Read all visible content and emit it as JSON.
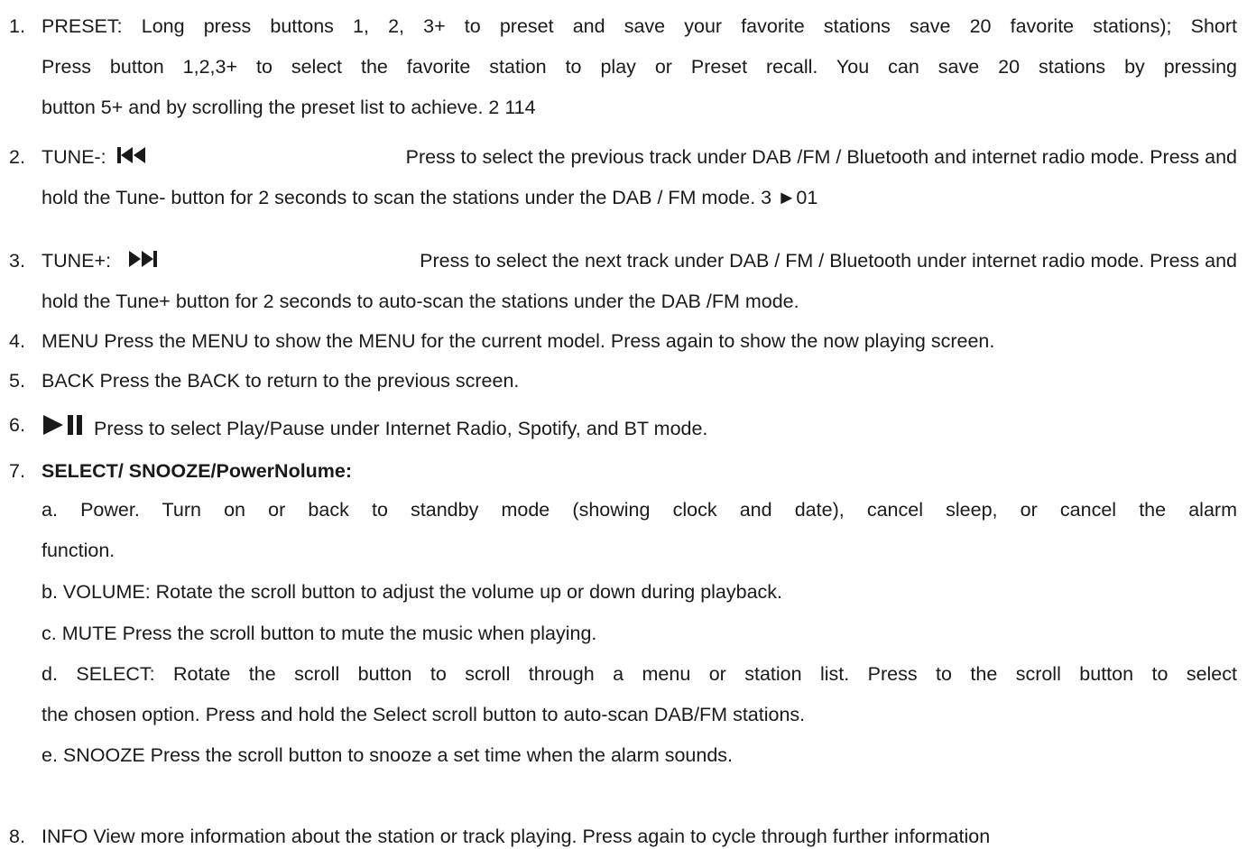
{
  "items": [
    {
      "number": "1.",
      "lines": [
        "PRESET: Long press buttons 1, 2, 3+ to preset and save your favorite stations save 20 favorite stations); Short",
        "Press button 1,2,3+ to select the favorite station to play or Preset recall. You can save 20 stations by pressing",
        "button 5+ and by scrolling the preset list to achieve. 2 114"
      ]
    },
    {
      "number": "2.",
      "label": "TUNE-:",
      "icon": "skip-previous-icon",
      "line1_rest": "Press to select the previous track under DAB /FM / Bluetooth and internet radio mode. Press and",
      "line2": "hold the Tune- button for 2 seconds to scan the stations under the DAB / FM mode. 3 ►01"
    },
    {
      "number": "3.",
      "label": "TUNE+:",
      "icon": "skip-next-icon",
      "line1_rest": "Press to select the next track under DAB / FM / Bluetooth under internet radio mode. Press and",
      "line2": "hold the Tune+ button for 2 seconds to auto-scan the stations under the DAB /FM mode."
    },
    {
      "number": "4.",
      "text": "MENU Press the MENU to show the MENU for the current model. Press again to show the now playing screen."
    },
    {
      "number": "5.",
      "text": "BACK Press the BACK to return to the previous screen."
    },
    {
      "number": "6.",
      "icon": "play-pause-icon",
      "text": "Press to select Play/Pause under Internet Radio, Spotify, and BT mode."
    },
    {
      "number": "7.",
      "heading": "SELECT/ SNOOZE/PowerNolume:",
      "sub": {
        "a_line1": "a. Power. Turn on or back to standby mode (showing clock and date), cancel sleep, or cancel the alarm",
        "a_line2": "function.",
        "b": "b. VOLUME: Rotate the scroll button to adjust the volume up or down during playback.",
        "c": "c. MUTE Press the scroll button to mute the music when playing.",
        "d_line1": "d. SELECT: Rotate the scroll button to scroll through a menu or station list. Press to the scroll button to select",
        "d_line2": "the chosen option. Press and hold the Select scroll button to auto-scan DAB/FM stations.",
        "e": "e. SNOOZE Press the scroll button to snooze a set time when the alarm sounds."
      }
    },
    {
      "number": "8.",
      "text": "INFO View more information about the station or track playing. Press again to cycle through further information"
    }
  ],
  "colors": {
    "text": "#1a1a1a",
    "background": "#ffffff"
  }
}
